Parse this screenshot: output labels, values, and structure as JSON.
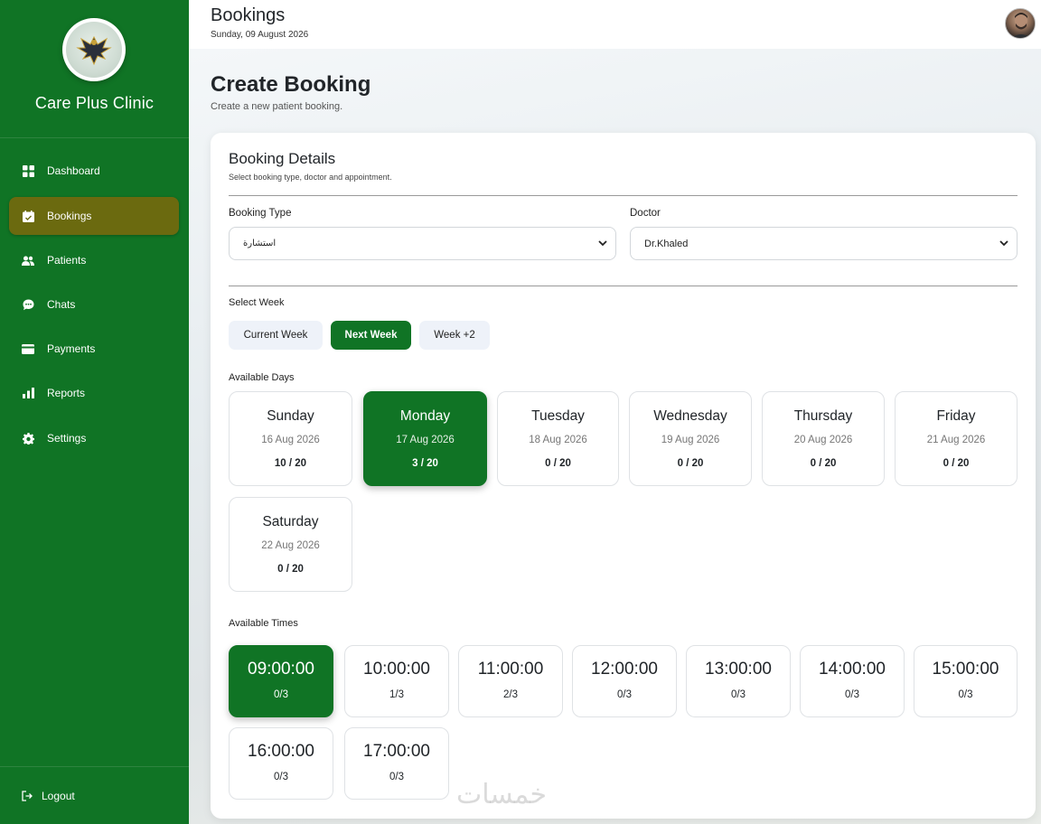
{
  "sidebar": {
    "clinic_name": "Care Plus Clinic",
    "items": [
      {
        "label": "Dashboard",
        "icon": "dashboard-icon",
        "active": false
      },
      {
        "label": "Bookings",
        "icon": "calendar-icon",
        "active": true
      },
      {
        "label": "Patients",
        "icon": "users-icon",
        "active": false
      },
      {
        "label": "Chats",
        "icon": "chat-icon",
        "active": false
      },
      {
        "label": "Payments",
        "icon": "credit-card-icon",
        "active": false
      },
      {
        "label": "Reports",
        "icon": "bar-chart-icon",
        "active": false
      },
      {
        "label": "Settings",
        "icon": "gear-icon",
        "active": false
      }
    ],
    "logout_label": "Logout"
  },
  "header": {
    "title": "Bookings",
    "date": "Sunday, 09 August 2026"
  },
  "page": {
    "title": "Create Booking",
    "subtitle": "Create a new patient booking."
  },
  "card": {
    "title": "Booking Details",
    "subtitle": "Select booking type, doctor and appointment.",
    "booking_type_label": "Booking Type",
    "booking_type_value": "استشارة",
    "doctor_label": "Doctor",
    "doctor_value": "Dr.Khaled",
    "select_week_label": "Select Week",
    "weeks": [
      {
        "label": "Current Week",
        "active": false
      },
      {
        "label": "Next Week",
        "active": true
      },
      {
        "label": "Week +2",
        "active": false
      }
    ],
    "available_days_label": "Available Days",
    "days": [
      {
        "name": "Sunday",
        "date": "16 Aug 2026",
        "count": "10 / 20",
        "active": false
      },
      {
        "name": "Monday",
        "date": "17 Aug 2026",
        "count": "3 / 20",
        "active": true
      },
      {
        "name": "Tuesday",
        "date": "18 Aug 2026",
        "count": "0 / 20",
        "active": false
      },
      {
        "name": "Wednesday",
        "date": "19 Aug 2026",
        "count": "0 / 20",
        "active": false
      },
      {
        "name": "Thursday",
        "date": "20 Aug 2026",
        "count": "0 / 20",
        "active": false
      },
      {
        "name": "Friday",
        "date": "21 Aug 2026",
        "count": "0 / 20",
        "active": false
      },
      {
        "name": "Saturday",
        "date": "22 Aug 2026",
        "count": "0 / 20",
        "active": false
      }
    ],
    "available_times_label": "Available Times",
    "times": [
      {
        "time": "09:00:00",
        "count": "0/3",
        "active": true
      },
      {
        "time": "10:00:00",
        "count": "1/3",
        "active": false
      },
      {
        "time": "11:00:00",
        "count": "2/3",
        "active": false
      },
      {
        "time": "12:00:00",
        "count": "0/3",
        "active": false
      },
      {
        "time": "13:00:00",
        "count": "0/3",
        "active": false
      },
      {
        "time": "14:00:00",
        "count": "0/3",
        "active": false
      },
      {
        "time": "15:00:00",
        "count": "0/3",
        "active": false
      },
      {
        "time": "16:00:00",
        "count": "0/3",
        "active": false
      },
      {
        "time": "17:00:00",
        "count": "0/3",
        "active": false
      }
    ]
  },
  "watermark": "خمسات",
  "colors": {
    "primary_green": "#107425",
    "active_nav": "#6b6a0f",
    "week_inactive_bg": "#eef2f9"
  }
}
